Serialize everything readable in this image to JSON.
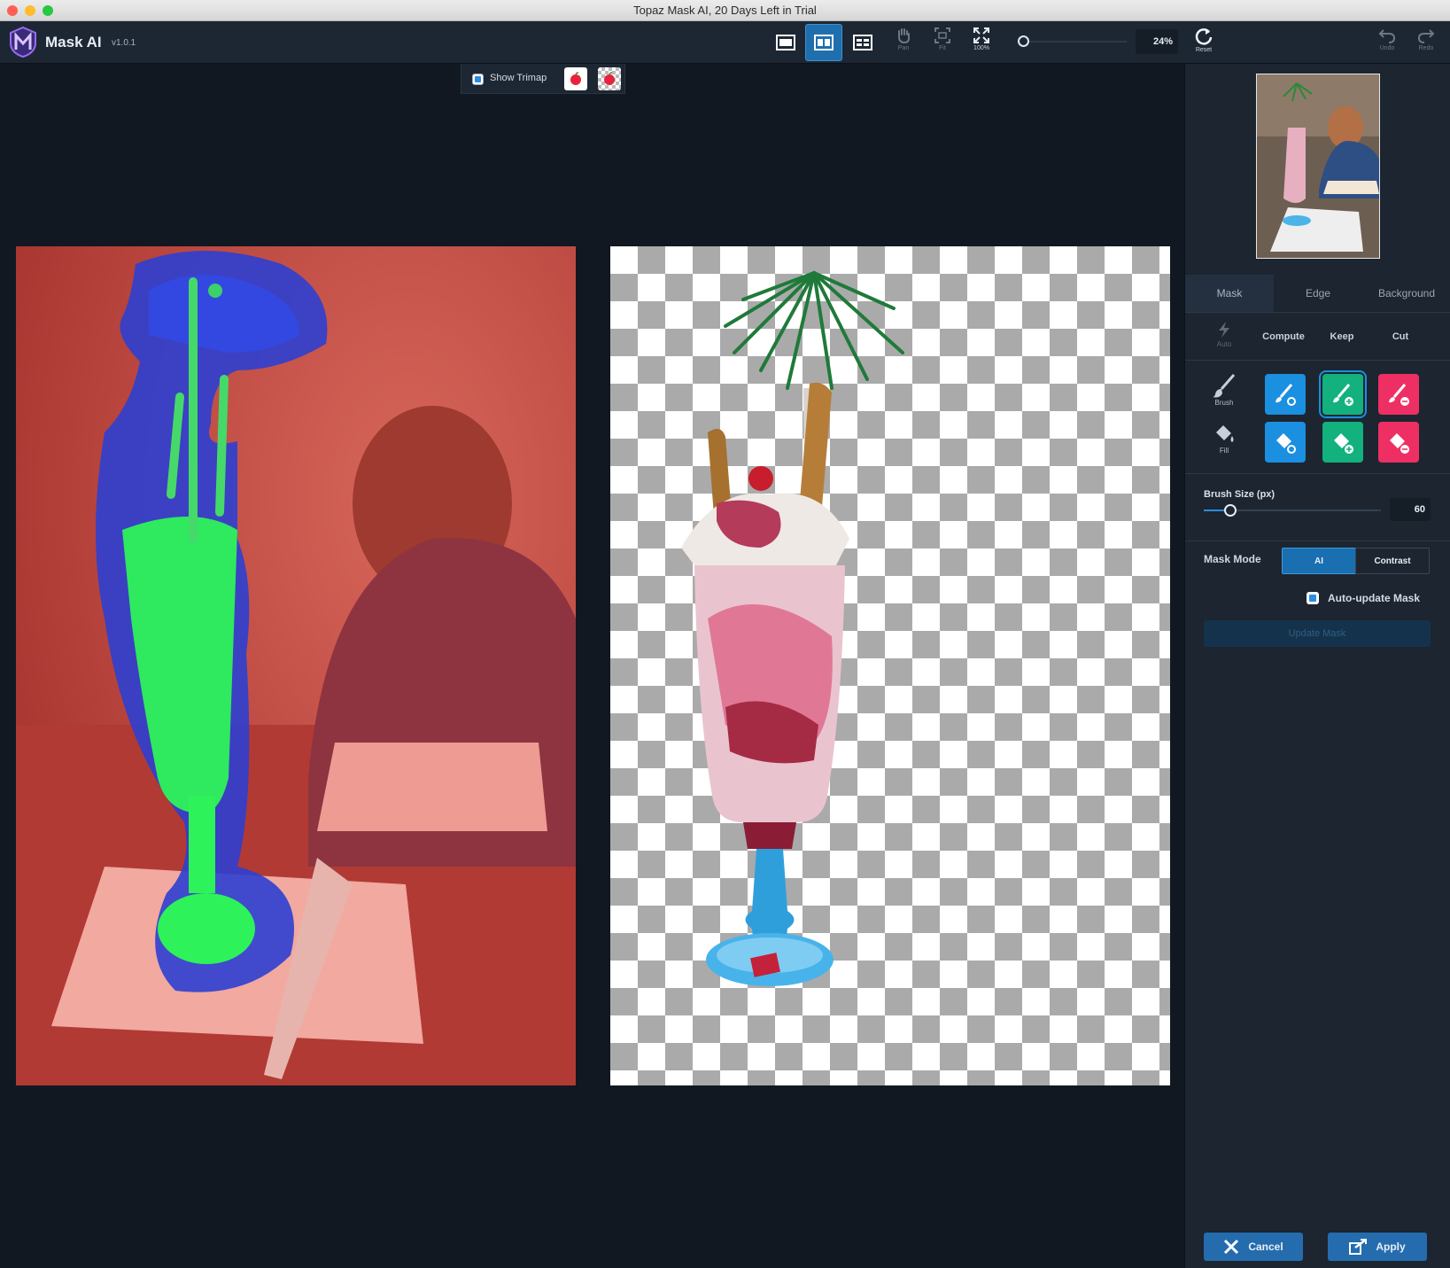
{
  "window": {
    "title": "Topaz Mask AI, 20 Days Left in Trial"
  },
  "app": {
    "name": "Mask AI",
    "version": "v1.0.1"
  },
  "toolbar": {
    "tools": {
      "pan": "Pan",
      "fit": "Fit",
      "full": "100%",
      "reset": "Reset",
      "undo": "Undo",
      "redo": "Redo"
    },
    "zoom_percent": "24%",
    "view_modes": [
      "single-view",
      "side-by-side",
      "split-view"
    ],
    "selected_view_mode": "side-by-side"
  },
  "trimap": {
    "label": "Show Trimap",
    "checked": true
  },
  "panel": {
    "tabs": [
      "Mask",
      "Edge",
      "Background"
    ],
    "selected_tab": "Mask",
    "columns": {
      "auto": "Auto",
      "compute": "Compute",
      "keep": "Keep",
      "cut": "Cut"
    },
    "rows": {
      "brush": "Brush",
      "fill": "Fill"
    },
    "active_tool": "keep-brush",
    "brush_size_label": "Brush Size (px)",
    "brush_size_value": "60",
    "brush_size_fraction": 0.15,
    "mask_mode_label": "Mask Mode",
    "mask_modes": [
      "AI",
      "Contrast"
    ],
    "selected_mask_mode": "AI",
    "auto_update_label": "Auto-update Mask",
    "auto_update_checked": true,
    "update_mask_label": "Update Mask"
  },
  "footer": {
    "cancel": "Cancel",
    "apply": "Apply"
  },
  "colors": {
    "accent": "#1b8fe0",
    "keep": "#12b17d",
    "cut": "#ee2f64",
    "background": "#111822",
    "panel": "#1c2530"
  }
}
